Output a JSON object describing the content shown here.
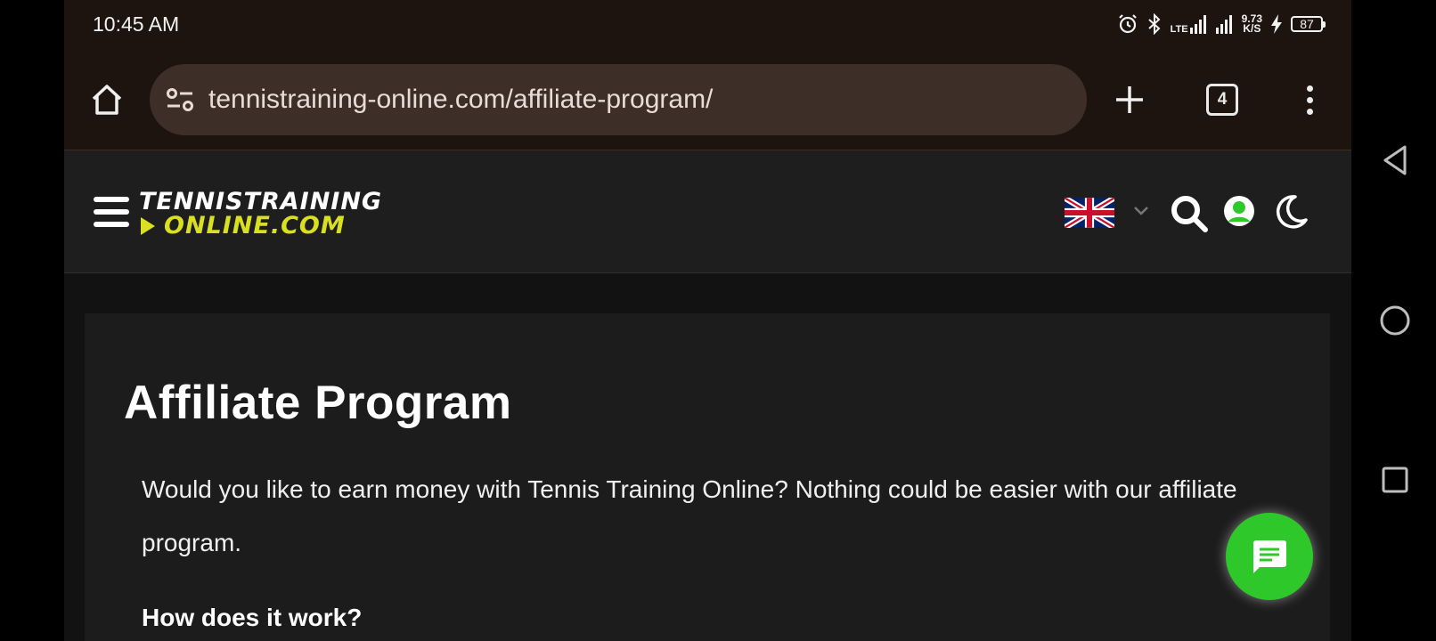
{
  "status_bar": {
    "time": "10:45 AM",
    "lte": "LTE",
    "net_speed_value": "9.73",
    "net_speed_unit": "K/S",
    "battery": "87"
  },
  "browser": {
    "url": "tennistraining-online.com/affiliate-program/",
    "tab_count": "4"
  },
  "site_header": {
    "logo_line1": "TENNISTRAINING",
    "logo_line2": "ONLINE.COM",
    "language": "English (UK flag)"
  },
  "page": {
    "title": "Affiliate Program",
    "intro": "Would you like to earn money with Tennis Training Online? Nothing could be easier with our affiliate program.",
    "subheading": "How does it work?"
  },
  "colors": {
    "accent_green": "#2ec82a",
    "logo_yellow": "#d9e021",
    "browser_bar": "#1d1410",
    "url_field": "#3d2f27"
  },
  "icons": [
    "home-icon",
    "site-info-icon",
    "plus-icon",
    "tab-switcher-icon",
    "more-vert-icon",
    "menu-icon",
    "uk-flag-icon",
    "chevron-down-icon",
    "search-icon",
    "user-icon",
    "moon-icon",
    "chat-icon",
    "back-icon",
    "home-circle-icon",
    "recents-icon"
  ]
}
